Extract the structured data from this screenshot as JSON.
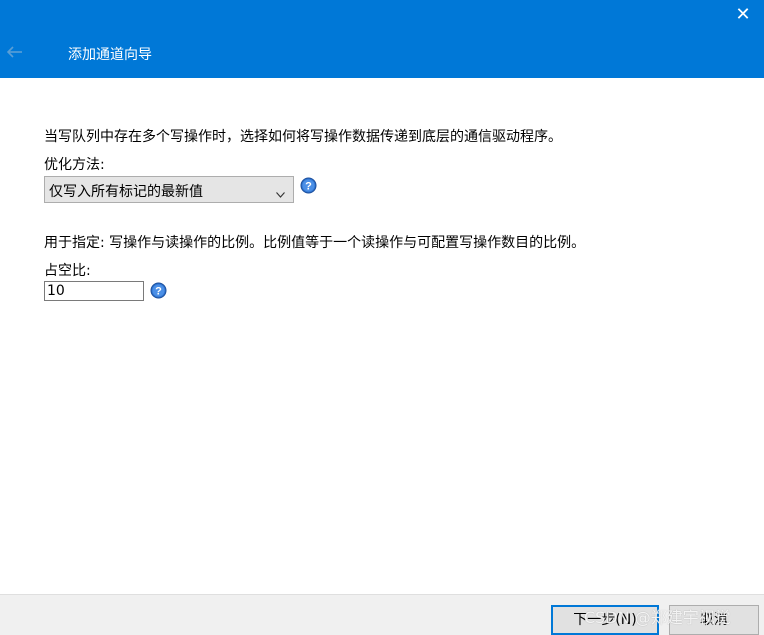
{
  "header": {
    "title": "添加通道向导",
    "close_icon": "close-icon",
    "back_icon": "back-arrow-icon",
    "back_color": "#5a9fd6",
    "bg_color": "#0078d7"
  },
  "main": {
    "description_1": "当写队列中存在多个写操作时，选择如何将写操作数据传递到底层的通信驱动程序。",
    "optimization_label": "优化方法:",
    "optimization_select": {
      "value": "仅写入所有标记的最新值",
      "icon": "chevron-down-icon"
    },
    "description_2": "用于指定: 写操作与读操作的比例。比例值等于一个读操作与可配置写操作数目的比例。",
    "duty_ratio_label": "占空比:",
    "duty_ratio_value": "10",
    "help_icon": "help-icon"
  },
  "footer": {
    "next_label": "下一步(N)",
    "cancel_label": "取消",
    "watermark": "CSDN @郑建宇视觉"
  }
}
